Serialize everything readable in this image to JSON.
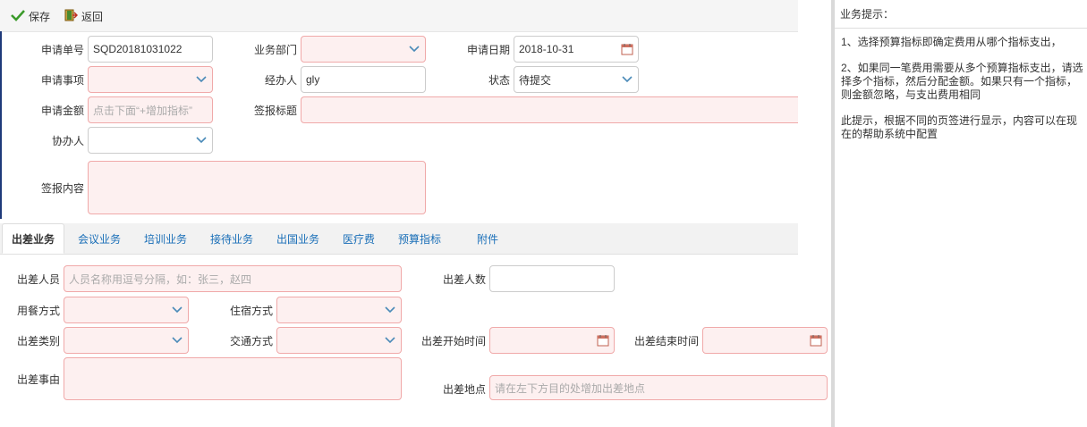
{
  "toolbar": {
    "save_label": "保存",
    "back_label": "返回"
  },
  "form": {
    "apply_no_label": "申请单号",
    "apply_no_value": "SQD20181031022",
    "dept_label": "业务部门",
    "apply_date_label": "申请日期",
    "apply_date_value": "2018-10-31",
    "item_label": "申请事项",
    "handler_label": "经办人",
    "handler_value": "gly",
    "status_label": "状态",
    "status_value": "待提交",
    "amount_label": "申请金额",
    "amount_placeholder": "点击下面“+增加指标”",
    "sign_title_label": "签报标题",
    "co_handler_label": "协办人",
    "sign_content_label": "签报内容"
  },
  "tabs": [
    {
      "label": "出差业务",
      "active": true
    },
    {
      "label": "会议业务"
    },
    {
      "label": "培训业务"
    },
    {
      "label": "接待业务"
    },
    {
      "label": "出国业务"
    },
    {
      "label": "医疗费"
    },
    {
      "label": "预算指标"
    },
    {
      "label": "附件"
    }
  ],
  "trip": {
    "staff_label": "出差人员",
    "staff_placeholder": "人员名称用逗号分隔，如：张三，赵四",
    "count_label": "出差人数",
    "meal_label": "用餐方式",
    "lodging_label": "住宿方式",
    "type_label": "出差类别",
    "transport_label": "交通方式",
    "start_label": "出差开始时间",
    "end_label": "出差结束时间",
    "reason_label": "出差事由",
    "place_label": "出差地点",
    "place_placeholder": "请在左下方目的处增加出差地点"
  },
  "hint": {
    "title": "业务提示：",
    "p1": "1、选择预算指标即确定费用从哪个指标支出，",
    "p2": "2、如果同一笔费用需要从多个预算指标支出，请选择多个指标，然后分配金额。如果只有一个指标，则金额忽略，与支出费用相同",
    "p3": "此提示，根据不同的页签进行显示，内容可以在现在的帮助系统中配置"
  },
  "colors": {
    "required_bg": "#fdf0f0",
    "required_border": "#f0a9a9",
    "tab_link": "#1a6fb8",
    "accent_bar": "#1f3a7a"
  }
}
